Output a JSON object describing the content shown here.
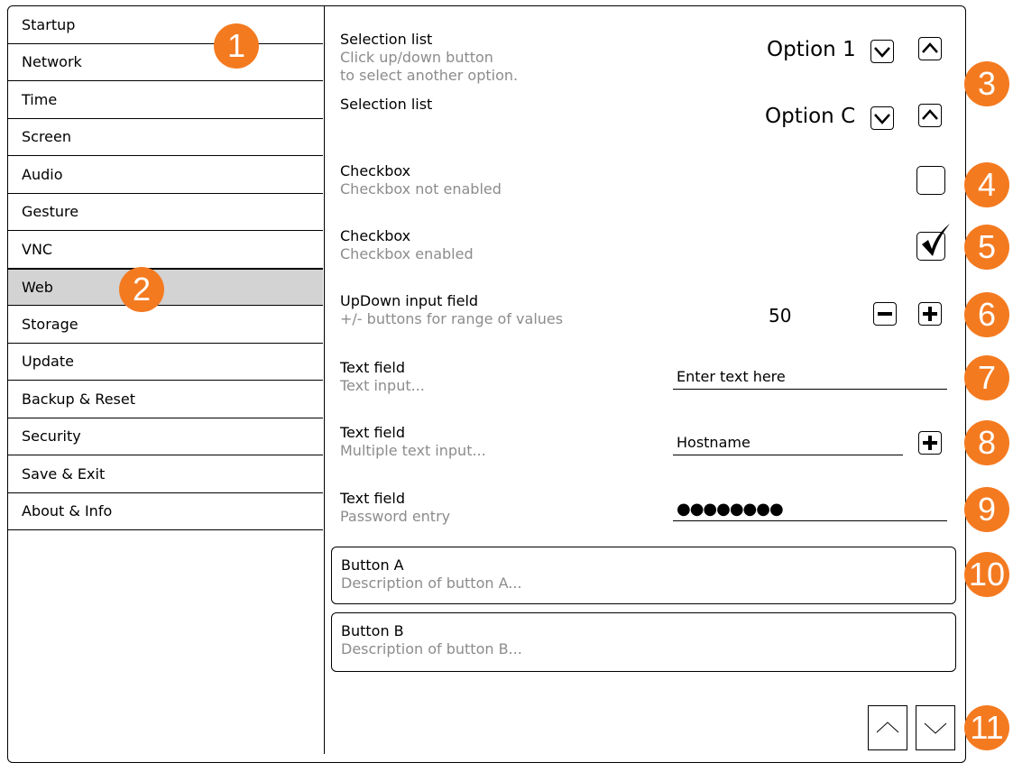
{
  "sidebar": {
    "items": [
      {
        "label": "Startup"
      },
      {
        "label": "Network"
      },
      {
        "label": "Time"
      },
      {
        "label": "Screen"
      },
      {
        "label": "Audio"
      },
      {
        "label": "Gesture"
      },
      {
        "label": "VNC"
      },
      {
        "label": "Web",
        "selected": true
      },
      {
        "label": "Storage"
      },
      {
        "label": "Update"
      },
      {
        "label": "Backup & Reset"
      },
      {
        "label": "Security"
      },
      {
        "label": "Save & Exit"
      },
      {
        "label": "About & Info"
      }
    ]
  },
  "settings": {
    "selection1": {
      "label": "Selection list",
      "desc_line1": "Click up/down button",
      "desc_line2": "to select another option.",
      "value": "Option 1"
    },
    "selection2": {
      "label": "Selection list",
      "value": "Option C"
    },
    "checkbox1": {
      "label": "Checkbox",
      "desc": "Checkbox not enabled",
      "checked": false
    },
    "checkbox2": {
      "label": "Checkbox",
      "desc": "Checkbox enabled",
      "checked": true
    },
    "updown": {
      "label": "UpDown input field",
      "desc": "+/- buttons for range of values",
      "value": "50"
    },
    "text1": {
      "label": "Text field",
      "desc": "Text input...",
      "value": "Enter text here"
    },
    "text2": {
      "label": "Text field",
      "desc": "Multiple text input...",
      "value": "Hostname"
    },
    "password": {
      "label": "Text field",
      "desc": "Password entry",
      "value": "●●●●●●●●"
    },
    "buttonA": {
      "label": "Button A",
      "desc": "Description of button A..."
    },
    "buttonB": {
      "label": "Button B",
      "desc": "Description of button B..."
    }
  },
  "callouts": [
    "1",
    "2",
    "3",
    "4",
    "5",
    "6",
    "7",
    "8",
    "9",
    "10",
    "11"
  ],
  "colors": {
    "callout": "#f47a20",
    "selected_bg": "#d3d3d3",
    "desc_text": "#8c8c8c"
  }
}
